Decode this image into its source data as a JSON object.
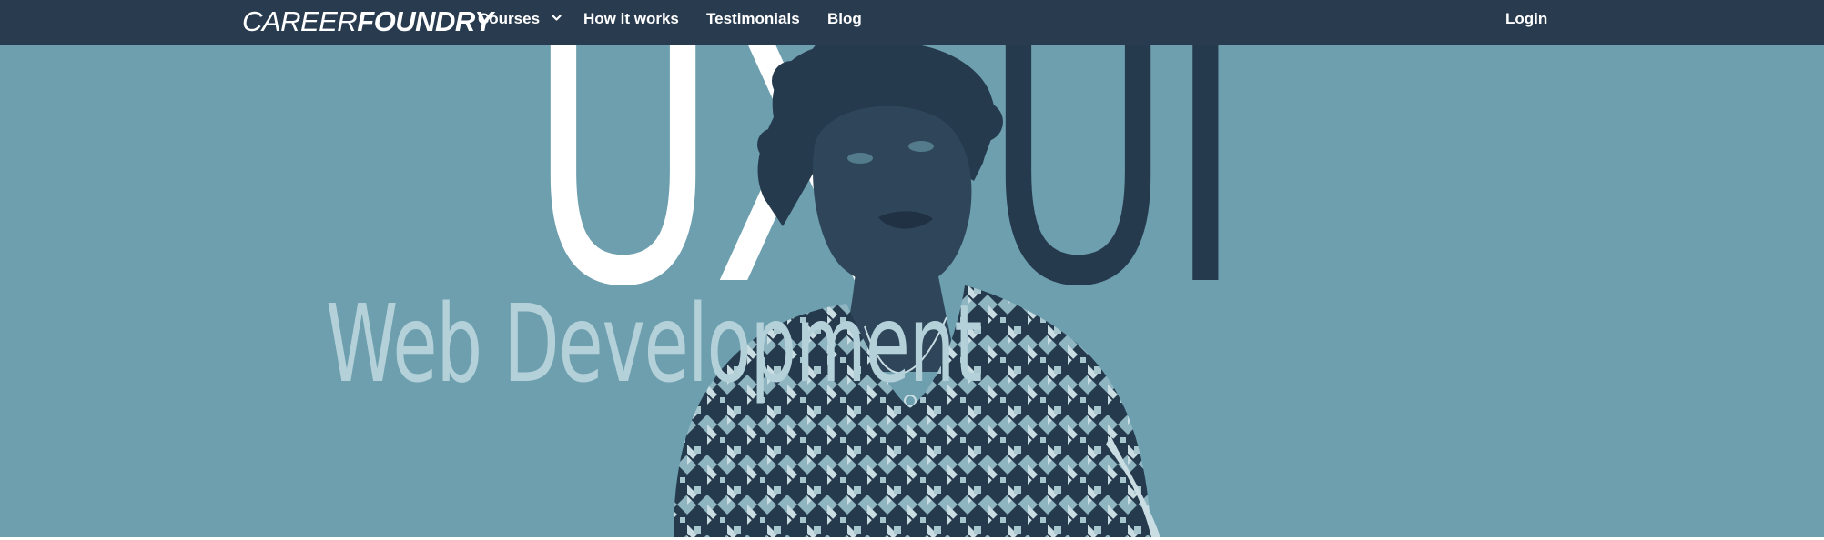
{
  "nav": {
    "logo_light": "CAREER",
    "logo_bold": "FOUNDRY",
    "courses_label": "Courses",
    "how_label": "How it works",
    "testimonials_label": "Testimonials",
    "blog_label": "Blog",
    "login_label": "Login"
  },
  "hero": {
    "word_ux": "UX",
    "word_ui": "UI",
    "word_web": "Web Development"
  },
  "colors": {
    "nav_bg": "#283b4f",
    "hero_bg": "#6d9fae",
    "ux_text": "#ffffff",
    "ui_text": "#263a4d",
    "web_text": "#b4d1da"
  },
  "icons": {
    "courses_dropdown": "chevron-down-icon"
  }
}
